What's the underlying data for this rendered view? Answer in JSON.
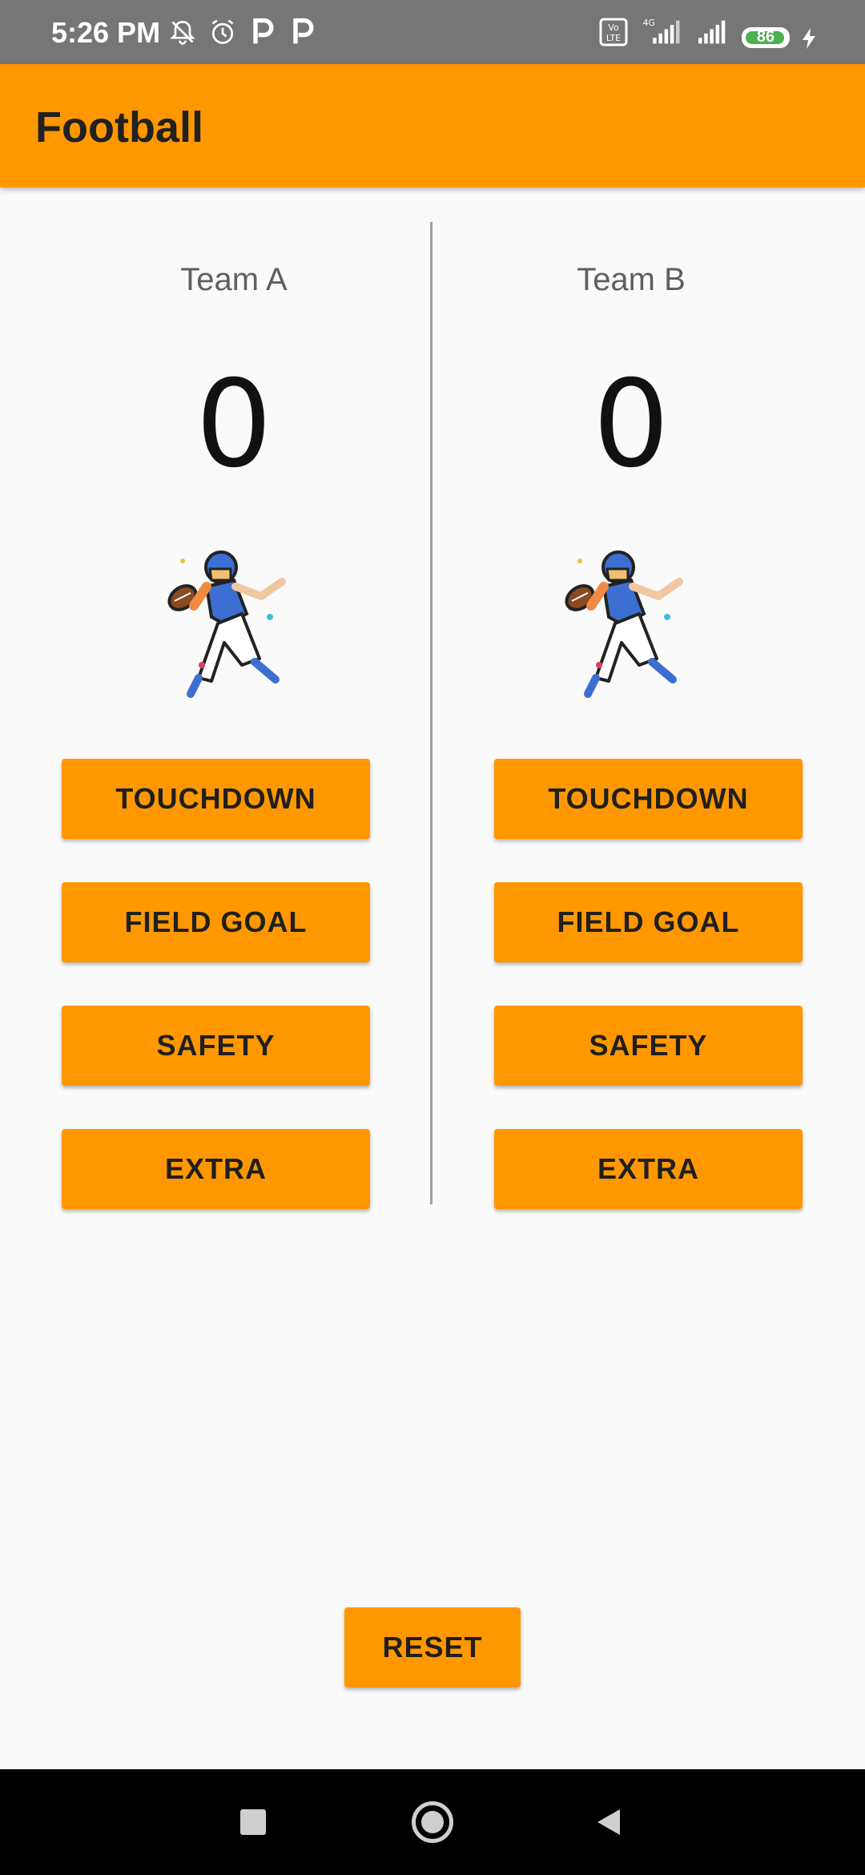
{
  "status_bar": {
    "time": "5:26 PM",
    "battery": "86",
    "network": "4G",
    "volte": "Vo LTE"
  },
  "app_bar": {
    "title": "Football"
  },
  "team_a": {
    "name": "Team A",
    "score": "0",
    "buttons": {
      "touchdown": "TOUCHDOWN",
      "field_goal": "FIELD GOAL",
      "safety": "SAFETY",
      "extra": "EXTRA"
    }
  },
  "team_b": {
    "name": "Team B",
    "score": "0",
    "buttons": {
      "touchdown": "TOUCHDOWN",
      "field_goal": "FIELD GOAL",
      "safety": "SAFETY",
      "extra": "EXTRA"
    }
  },
  "reset_label": "RESET",
  "colors": {
    "accent": "#ff9800",
    "status_bar": "#767676",
    "battery_green": "#4caf50"
  }
}
